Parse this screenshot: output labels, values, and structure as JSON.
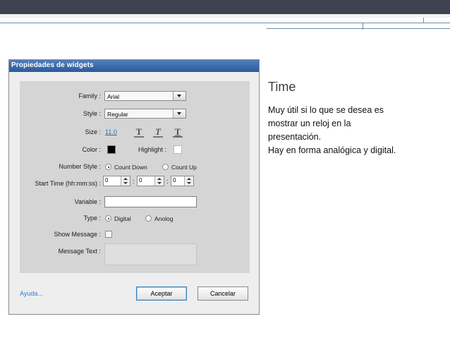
{
  "dialog": {
    "title": "Propiedades de widgets",
    "fields": {
      "family_label": "Family :",
      "family_value": "Arial",
      "style_label": "Style :",
      "style_value": "Regular",
      "size_label": "Size :",
      "size_value": "11.0",
      "format_buttons": [
        "T",
        "T",
        "T"
      ],
      "color_label": "Color :",
      "color_value": "#000000",
      "highlight_label": "Highlight :",
      "highlight_value": "#ffffff",
      "number_style_label": "Number Style :",
      "number_style_options": [
        "Count Down",
        "Count Up"
      ],
      "number_style_selected": "Count Down",
      "start_time_label": "Start Time (hh:mm:ss) :",
      "start_time_hh": "0",
      "start_time_mm": "0",
      "start_time_ss": "0",
      "time_separator": ":",
      "variable_label": "Variable :",
      "variable_value": "",
      "type_label": "Type :",
      "type_options": [
        "Digital",
        "Anolog"
      ],
      "type_selected": "Digital",
      "show_message_label": "Show Message :",
      "show_message_checked": false,
      "message_text_label": "Message Text :",
      "message_text_value": ""
    },
    "footer": {
      "help_label": "Ayuda...",
      "accept_label": "Aceptar",
      "cancel_label": "Cancelar"
    }
  },
  "slide": {
    "title": "Time",
    "body_lines": [
      "Muy útil si lo que se desea es",
      "mostrar un reloj en la",
      "presentación.",
      "Hay en forma analógica y digital."
    ]
  },
  "colors": {
    "header_band": "#3f4250",
    "title_bar": "#2c5a9a",
    "link": "#2a6bc0"
  },
  "icons": [
    "dropdown-arrow-icon",
    "spin-up-icon",
    "spin-down-icon",
    "bold-icon",
    "italic-icon",
    "underline-icon"
  ]
}
